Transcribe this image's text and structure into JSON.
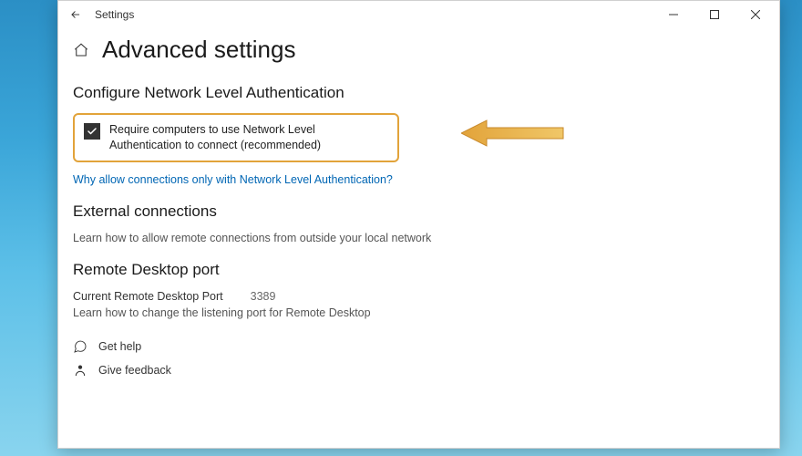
{
  "window": {
    "title": "Settings"
  },
  "page": {
    "title": "Advanced settings"
  },
  "nla": {
    "heading": "Configure Network Level Authentication",
    "checkbox_label": "Require computers to use Network Level Authentication to connect (recommended)",
    "link": "Why allow connections only with Network Level Authentication?"
  },
  "external": {
    "heading": "External connections",
    "desc": "Learn how to allow remote connections from outside your local network"
  },
  "rdp": {
    "heading": "Remote Desktop port",
    "port_label": "Current Remote Desktop Port",
    "port_value": "3389",
    "desc": "Learn how to change the listening port for Remote Desktop"
  },
  "footer": {
    "help": "Get help",
    "feedback": "Give feedback"
  }
}
